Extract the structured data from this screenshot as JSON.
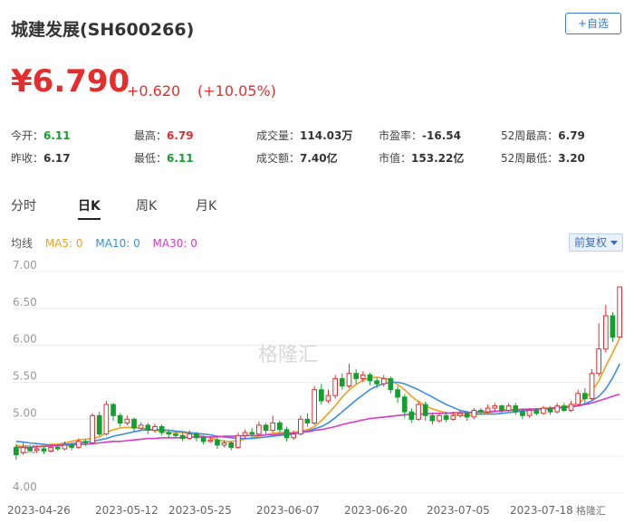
{
  "stock": {
    "name_code": "城建发展(SH600266)",
    "fav_label": "+自选",
    "price": "¥6.790",
    "change": "+0.620",
    "change_pct": "(+10.05%)"
  },
  "stats": {
    "open_label": "今开：",
    "open": "6.11",
    "prev_label": "昨收：",
    "prev": "6.17",
    "high_label": "最高：",
    "high": "6.79",
    "low_label": "最低：",
    "low": "6.11",
    "vol_label": "成交量：",
    "vol": "114.03万",
    "amt_label": "成交额：",
    "amt": "7.40亿",
    "pe_label": "市盈率：",
    "pe": "-16.54",
    "mcap_label": "市值：",
    "mcap": "153.22亿",
    "h52_label": "52周最高：",
    "h52": "6.79",
    "l52_label": "52周最低：",
    "l52": "3.20"
  },
  "tabs": [
    "分时",
    "日K",
    "周K",
    "月K"
  ],
  "active_tab": "日K",
  "ma": {
    "label": "均线",
    "ma5": "MA5: 0",
    "ma10": "MA10: 0",
    "ma30": "MA30: 0",
    "ma5_color": "#f2a01e",
    "ma10_color": "#3a8ee6",
    "ma30_color": "#d63bc8"
  },
  "adjust_label": "前复权",
  "watermark": "格隆汇",
  "colors": {
    "up": "#e62d2d",
    "down": "#14a02e",
    "accent": "#3a7bd5"
  },
  "chart_data": {
    "type": "candlestick",
    "y_ticks": [
      "7.00",
      "6.50",
      "6.00",
      "5.50",
      "5.00",
      "4.50",
      "4.00"
    ],
    "ylim": [
      4.0,
      7.0
    ],
    "x_labels": [
      "2023-04-26",
      "2023-05-12",
      "2023-05-25",
      "2023-06-07",
      "2023-06-20",
      "2023-07-05",
      "2023-07-18"
    ],
    "series": [
      {
        "name": "MA5",
        "values": [
          4.65,
          4.63,
          4.62,
          4.63,
          4.64,
          4.66,
          4.66,
          4.68,
          4.7,
          4.72,
          4.73,
          4.74,
          4.76,
          4.82,
          4.86,
          4.88,
          4.89,
          4.89,
          4.88,
          4.86,
          4.85,
          4.84,
          4.82,
          4.82,
          4.82,
          4.8,
          4.79,
          4.77,
          4.75,
          4.72,
          4.7,
          4.7,
          4.71,
          4.73,
          4.75,
          4.77,
          4.79,
          4.81,
          4.82,
          4.82,
          4.82,
          4.84,
          4.86,
          4.9,
          4.98,
          5.08,
          5.18,
          5.3,
          5.4,
          5.47,
          5.53,
          5.56,
          5.57,
          5.55,
          5.53,
          5.47,
          5.4,
          5.31,
          5.24,
          5.18,
          5.14,
          5.11,
          5.09,
          5.07,
          5.05,
          5.05,
          5.06,
          5.07,
          5.09,
          5.1,
          5.12,
          5.13,
          5.13,
          5.14,
          5.14,
          5.14,
          5.15,
          5.15,
          5.16,
          5.17,
          5.18,
          5.22,
          5.28,
          5.38,
          5.52,
          5.72,
          5.9,
          6.1
        ]
      },
      {
        "name": "MA10",
        "values": [
          4.7,
          4.69,
          4.68,
          4.67,
          4.66,
          4.65,
          4.65,
          4.66,
          4.67,
          4.68,
          4.69,
          4.7,
          4.72,
          4.74,
          4.77,
          4.79,
          4.81,
          4.83,
          4.85,
          4.86,
          4.86,
          4.86,
          4.85,
          4.84,
          4.83,
          4.82,
          4.81,
          4.8,
          4.79,
          4.77,
          4.76,
          4.75,
          4.74,
          4.74,
          4.74,
          4.75,
          4.76,
          4.77,
          4.78,
          4.79,
          4.8,
          4.82,
          4.84,
          4.87,
          4.9,
          4.95,
          5.02,
          5.1,
          5.18,
          5.26,
          5.33,
          5.4,
          5.45,
          5.48,
          5.5,
          5.5,
          5.48,
          5.44,
          5.4,
          5.35,
          5.3,
          5.25,
          5.2,
          5.16,
          5.12,
          5.1,
          5.08,
          5.07,
          5.07,
          5.07,
          5.08,
          5.09,
          5.1,
          5.11,
          5.12,
          5.13,
          5.14,
          5.14,
          5.15,
          5.16,
          5.17,
          5.18,
          5.21,
          5.25,
          5.31,
          5.41,
          5.56,
          5.75
        ]
      },
      {
        "name": "MA30",
        "values": [
          4.62,
          4.62,
          4.62,
          4.63,
          4.63,
          4.64,
          4.64,
          4.65,
          4.65,
          4.66,
          4.66,
          4.67,
          4.68,
          4.69,
          4.7,
          4.7,
          4.71,
          4.72,
          4.73,
          4.74,
          4.74,
          4.75,
          4.75,
          4.75,
          4.75,
          4.76,
          4.76,
          4.76,
          4.76,
          4.76,
          4.77,
          4.77,
          4.77,
          4.78,
          4.78,
          4.78,
          4.79,
          4.79,
          4.8,
          4.81,
          4.81,
          4.82,
          4.83,
          4.85,
          4.86,
          4.88,
          4.9,
          4.93,
          4.95,
          4.97,
          4.99,
          5.01,
          5.02,
          5.03,
          5.04,
          5.05,
          5.06,
          5.07,
          5.07,
          5.07,
          5.08,
          5.08,
          5.08,
          5.09,
          5.09,
          5.09,
          5.1,
          5.1,
          5.1,
          5.11,
          5.11,
          5.12,
          5.12,
          5.13,
          5.13,
          5.14,
          5.14,
          5.15,
          5.16,
          5.16,
          5.17,
          5.18,
          5.2,
          5.22,
          5.25,
          5.28,
          5.31,
          5.34
        ]
      }
    ],
    "candles": [
      [
        4.62,
        4.52,
        4.66,
        4.45
      ],
      [
        4.55,
        4.62,
        4.68,
        4.52
      ],
      [
        4.62,
        4.58,
        4.66,
        4.55
      ],
      [
        4.58,
        4.6,
        4.65,
        4.54
      ],
      [
        4.6,
        4.57,
        4.63,
        4.53
      ],
      [
        4.57,
        4.62,
        4.65,
        4.55
      ],
      [
        4.62,
        4.6,
        4.66,
        4.57
      ],
      [
        4.6,
        4.65,
        4.7,
        4.58
      ],
      [
        4.65,
        4.62,
        4.68,
        4.58
      ],
      [
        4.62,
        4.7,
        4.74,
        4.6
      ],
      [
        4.7,
        4.68,
        4.73,
        4.64
      ],
      [
        4.68,
        5.05,
        5.08,
        4.66
      ],
      [
        5.05,
        4.8,
        5.1,
        4.77
      ],
      [
        4.8,
        5.2,
        5.25,
        4.78
      ],
      [
        5.2,
        5.05,
        5.22,
        4.98
      ],
      [
        5.05,
        4.95,
        5.08,
        4.9
      ],
      [
        4.95,
        5.0,
        5.05,
        4.92
      ],
      [
        5.0,
        4.88,
        5.02,
        4.84
      ],
      [
        4.88,
        4.92,
        4.96,
        4.85
      ],
      [
        4.92,
        4.85,
        4.95,
        4.8
      ],
      [
        4.85,
        4.9,
        4.94,
        4.82
      ],
      [
        4.9,
        4.82,
        4.93,
        4.78
      ],
      [
        4.82,
        4.8,
        4.86,
        4.75
      ],
      [
        4.8,
        4.78,
        4.84,
        4.74
      ],
      [
        4.78,
        4.74,
        4.82,
        4.7
      ],
      [
        4.74,
        4.8,
        4.85,
        4.72
      ],
      [
        4.8,
        4.75,
        4.83,
        4.7
      ],
      [
        4.75,
        4.7,
        4.78,
        4.66
      ],
      [
        4.7,
        4.72,
        4.76,
        4.68
      ],
      [
        4.72,
        4.65,
        4.75,
        4.6
      ],
      [
        4.65,
        4.68,
        4.72,
        4.62
      ],
      [
        4.68,
        4.62,
        4.7,
        4.58
      ],
      [
        4.62,
        4.78,
        4.82,
        4.6
      ],
      [
        4.78,
        4.82,
        4.86,
        4.74
      ],
      [
        4.82,
        4.8,
        4.88,
        4.76
      ],
      [
        4.8,
        4.92,
        4.97,
        4.78
      ],
      [
        4.92,
        4.85,
        4.95,
        4.8
      ],
      [
        4.85,
        4.95,
        5.05,
        4.82
      ],
      [
        4.95,
        4.86,
        4.98,
        4.82
      ],
      [
        4.86,
        4.75,
        4.9,
        4.7
      ],
      [
        4.75,
        4.8,
        4.85,
        4.72
      ],
      [
        4.8,
        5.0,
        5.05,
        4.78
      ],
      [
        5.0,
        4.95,
        5.08,
        4.9
      ],
      [
        4.95,
        5.4,
        5.45,
        4.92
      ],
      [
        5.4,
        5.25,
        5.48,
        5.2
      ],
      [
        5.25,
        5.32,
        5.4,
        5.22
      ],
      [
        5.32,
        5.55,
        5.6,
        5.28
      ],
      [
        5.55,
        5.45,
        5.62,
        5.4
      ],
      [
        5.45,
        5.62,
        5.75,
        5.42
      ],
      [
        5.62,
        5.55,
        5.68,
        5.48
      ],
      [
        5.55,
        5.6,
        5.65,
        5.5
      ],
      [
        5.6,
        5.52,
        5.63,
        5.46
      ],
      [
        5.52,
        5.48,
        5.56,
        5.42
      ],
      [
        5.48,
        5.55,
        5.6,
        5.44
      ],
      [
        5.55,
        5.4,
        5.58,
        5.35
      ],
      [
        5.4,
        5.3,
        5.45,
        5.22
      ],
      [
        5.3,
        5.1,
        5.34,
        5.02
      ],
      [
        5.1,
        5.0,
        5.15,
        4.95
      ],
      [
        5.0,
        5.2,
        5.25,
        4.98
      ],
      [
        5.2,
        5.05,
        5.24,
        4.98
      ],
      [
        5.05,
        4.98,
        5.08,
        4.93
      ],
      [
        4.98,
        5.05,
        5.08,
        4.95
      ],
      [
        5.05,
        5.0,
        5.1,
        4.96
      ],
      [
        5.0,
        5.05,
        5.1,
        4.98
      ],
      [
        5.05,
        5.08,
        5.12,
        5.02
      ],
      [
        5.08,
        5.03,
        5.1,
        4.98
      ],
      [
        5.03,
        5.12,
        5.15,
        5.0
      ],
      [
        5.12,
        5.1,
        5.15,
        5.06
      ],
      [
        5.1,
        5.15,
        5.2,
        5.08
      ],
      [
        5.15,
        5.18,
        5.22,
        5.12
      ],
      [
        5.18,
        5.12,
        5.2,
        5.08
      ],
      [
        5.12,
        5.18,
        5.22,
        5.1
      ],
      [
        5.18,
        5.1,
        5.22,
        5.06
      ],
      [
        5.1,
        5.05,
        5.14,
        5.0
      ],
      [
        5.05,
        5.12,
        5.15,
        5.02
      ],
      [
        5.12,
        5.08,
        5.15,
        5.05
      ],
      [
        5.08,
        5.15,
        5.18,
        5.06
      ],
      [
        5.15,
        5.1,
        5.18,
        5.06
      ],
      [
        5.1,
        5.18,
        5.22,
        5.08
      ],
      [
        5.18,
        5.12,
        5.22,
        5.1
      ],
      [
        5.12,
        5.2,
        5.25,
        5.1
      ],
      [
        5.2,
        5.35,
        5.4,
        5.18
      ],
      [
        5.35,
        5.28,
        5.42,
        5.22
      ],
      [
        5.28,
        5.62,
        5.68,
        5.26
      ],
      [
        5.62,
        5.95,
        6.3,
        5.58
      ],
      [
        5.95,
        6.4,
        6.55,
        5.9
      ],
      [
        6.4,
        6.11,
        6.45,
        6.05
      ],
      [
        6.11,
        6.79,
        6.79,
        6.11
      ]
    ]
  }
}
